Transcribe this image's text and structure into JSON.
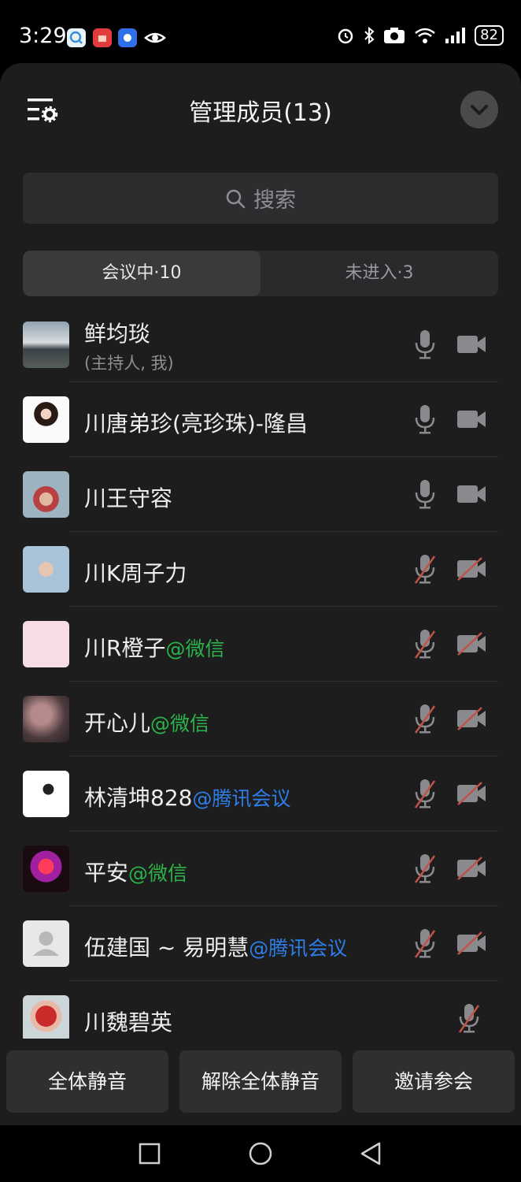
{
  "status_bar": {
    "time": "3:29",
    "battery": "82",
    "left_icons": [
      "chat-app-icon",
      "red-envelope-app-icon",
      "blue-app-icon",
      "eye-icon"
    ],
    "right_icons": [
      "alarm-icon",
      "bluetooth-icon",
      "camera-icon",
      "wifi-icon",
      "signal-icon",
      "battery-icon"
    ]
  },
  "header": {
    "title": "管理成员(13)"
  },
  "search": {
    "placeholder": "搜索"
  },
  "tabs": [
    {
      "label": "会议中·10",
      "active": true
    },
    {
      "label": "未进入·3",
      "active": false
    }
  ],
  "members": [
    {
      "name": "鲜均琰",
      "tag": "",
      "subtitle": "(主持人, 我)",
      "mic": "on",
      "camera": "on"
    },
    {
      "name": "川唐弟珍(亮珍珠)-隆昌",
      "tag": "",
      "subtitle": "",
      "mic": "on",
      "camera": "on"
    },
    {
      "name": "川王守容",
      "tag": "",
      "subtitle": "",
      "mic": "on",
      "camera": "on"
    },
    {
      "name": "川K周子力",
      "tag": "",
      "subtitle": "",
      "mic": "muted",
      "camera": "off"
    },
    {
      "name": "川R橙子",
      "tag": "@微信",
      "subtitle": "",
      "mic": "muted",
      "camera": "off"
    },
    {
      "name": "开心儿",
      "tag": "@微信",
      "subtitle": "",
      "mic": "muted",
      "camera": "off"
    },
    {
      "name": "林清坤828",
      "tag": "@腾讯会议",
      "subtitle": "",
      "mic": "muted",
      "camera": "off"
    },
    {
      "name": "平安",
      "tag": "@微信",
      "subtitle": "",
      "mic": "muted",
      "camera": "off"
    },
    {
      "name": "伍建国 ~ 易明慧",
      "tag": "@腾讯会议",
      "subtitle": "",
      "mic": "muted",
      "camera": "off"
    },
    {
      "name": "川魏碧英",
      "tag": "",
      "subtitle": "",
      "mic": "muted",
      "camera": "none"
    }
  ],
  "buttons": {
    "mute_all": "全体静音",
    "unmute_all": "解除全体静音",
    "invite": "邀请参会"
  },
  "colors": {
    "wechat_tag": "#2bb34a",
    "tencent_tag": "#2d7ee8",
    "muted_slash": "#c0524a"
  }
}
